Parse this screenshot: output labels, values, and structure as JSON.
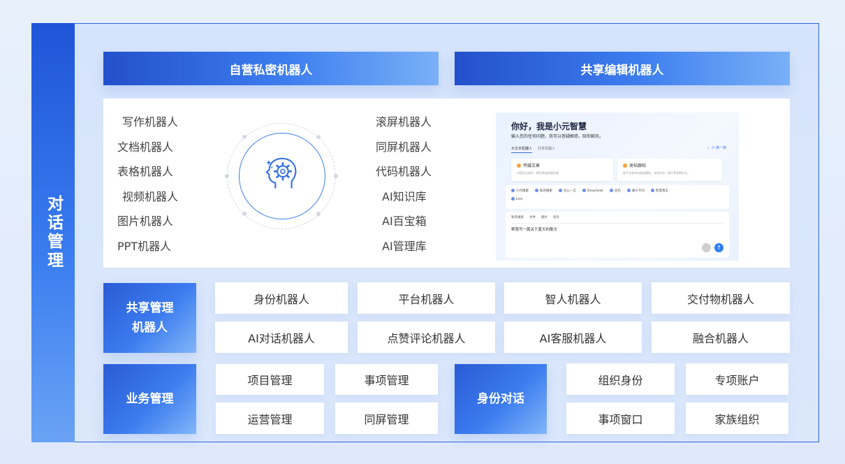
{
  "side_label": "对话管理",
  "headers": {
    "left": "自营私密机器人",
    "right": "共享编辑机器人"
  },
  "left_bots": [
    "写作机器人",
    "文档机器人",
    "表格机器人",
    "视频机器人",
    "图片机器人",
    "PPT机器人"
  ],
  "right_bots": [
    "滚屏机器人",
    "同屏机器人",
    "代码机器人",
    "AI知识库",
    "AI百宝箱",
    "AI管理库"
  ],
  "center_icon": "ai-head-gear-icon",
  "chat_mock": {
    "greeting": "你好，我是小元智慧",
    "subtitle": "输入您的任何问题，我可以答疑解惑，陪你聊天。",
    "tabs": [
      "大文本机器人",
      "共享机器人"
    ],
    "refresh": "换一换",
    "cards": [
      {
        "title": "传媒文章",
        "desc": "内容自主创作，撰写各类传媒文章"
      },
      {
        "title": "发帖跟帖",
        "desc": "各平台发布内容或跟帖，支持文字、图片等多种形式。"
      }
    ],
    "models": [
      "小元搜索",
      "私有搜索",
      "文心一言",
      "DeepSeek",
      "豆包",
      "通义千问",
      "智谱清言",
      "kimi"
    ],
    "input_opts": [
      "私有搜索",
      "文件",
      "图片",
      "指令"
    ],
    "input_text": "帮我写一篇关于夏天的散文"
  },
  "shared_mgmt": {
    "label_line1": "共享管理",
    "label_line2": "机器人",
    "items": [
      "身份机器人",
      "平台机器人",
      "智人机器人",
      "交付物机器人",
      "AI对话机器人",
      "点赞评论机器人",
      "AI客服机器人",
      "融合机器人"
    ]
  },
  "business": {
    "label": "业务管理",
    "items": [
      "项目管理",
      "事项管理",
      "运营管理",
      "同屏管理"
    ]
  },
  "identity": {
    "label": "身份对话",
    "items": [
      "组织身份",
      "专项账户",
      "事项窗口",
      "家族组织"
    ]
  }
}
